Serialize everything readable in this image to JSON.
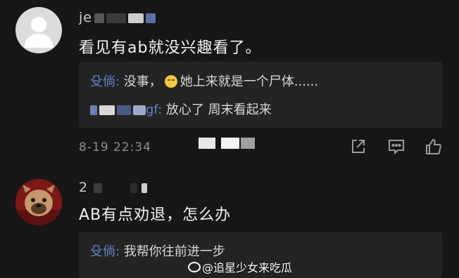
{
  "comments": [
    {
      "username": "je",
      "text": "看见有ab就没兴趣看了。",
      "replies": [
        {
          "author": "殳倘",
          "separator": ": ",
          "text_before": "没事，",
          "emoji": "smile-emoji",
          "text_after": "她上来就是一个尸体......"
        },
        {
          "author": "gf",
          "separator": ": ",
          "text": "放心了  周末看起来"
        }
      ],
      "timestamp": "8-19 22:34",
      "actions": [
        "share-icon",
        "comment-icon",
        "like-icon"
      ]
    },
    {
      "username": "2",
      "text": "AB有点劝退，怎么办",
      "replies": [
        {
          "author": "殳倘",
          "separator": ": ",
          "text": "我帮你往前进一步"
        }
      ]
    }
  ],
  "watermark": "@追星少女来吃瓜",
  "colors": {
    "background": "#161616",
    "reply_box": "#232323",
    "reply_author": "#5f86c9",
    "timestamp": "#8e8e8e"
  }
}
